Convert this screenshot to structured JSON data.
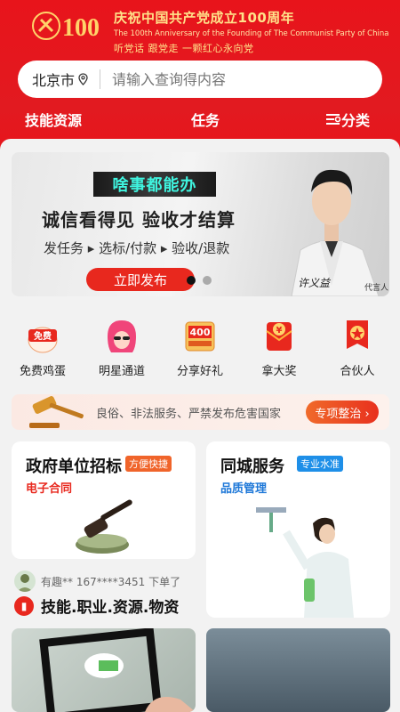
{
  "banner": {
    "title": "庆祝中国共产党成立100周年",
    "english": "The 100th Anniversary of the Founding of The Communist Party of China",
    "slogan": "听党话  跟党走  一颗红心永向党",
    "emblem_text": "100"
  },
  "search": {
    "city": "北京市",
    "placeholder": "请输入查询得内容"
  },
  "nav": {
    "items": [
      "技能资源",
      "任务",
      "分类"
    ]
  },
  "hero": {
    "tag": "啥事都能办",
    "headline": "诚信看得见  验收才结算",
    "steps": "发任务 ▸ 选标/付款 ▸ 验收/退款",
    "button": "立即发布",
    "spokesperson": "代言人",
    "signature": "许义益"
  },
  "quick_icons": [
    {
      "label": "免费鸡蛋",
      "badge": "免费",
      "icon": "free-egg-icon"
    },
    {
      "label": "明星通道",
      "icon": "star-channel-icon"
    },
    {
      "label": "分享好礼",
      "badge": "400",
      "icon": "share-gift-icon"
    },
    {
      "label": "拿大奖",
      "badge": "¥",
      "icon": "prize-icon"
    },
    {
      "label": "合伙人",
      "icon": "partner-icon"
    }
  ],
  "notice": {
    "text": "良俗、非法服务、严禁发布危害国家",
    "button": "专项整治 ›"
  },
  "cards": {
    "left": {
      "title": "政府单位招标",
      "tag": "方便快捷",
      "sub": "电子合同"
    },
    "right": {
      "title": "同城服务",
      "tag": "专业水准",
      "sub": "品质管理"
    }
  },
  "ticker": {
    "text": "有趣**  167****3451  下单了"
  },
  "skills": {
    "text": "技能.职业.资源.物资"
  },
  "colors": {
    "primary_red": "#e8141b",
    "gold": "#ffe28a",
    "tag_orange": "#f0642a",
    "tag_blue": "#1e8fe8"
  }
}
